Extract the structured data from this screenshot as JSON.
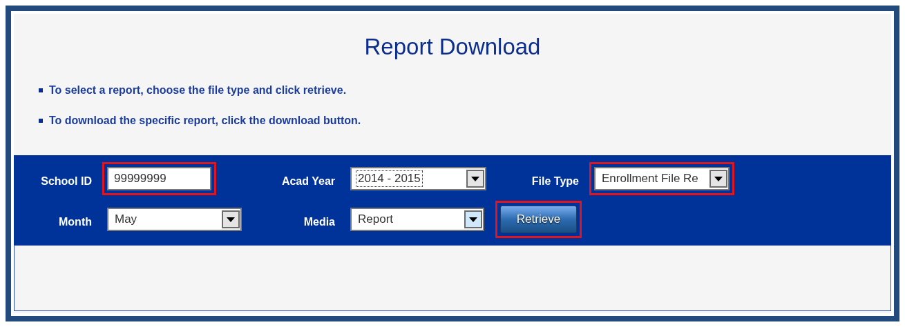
{
  "title": "Report Download",
  "instructions": [
    "To select a report, choose the file type and click retrieve.",
    "To download the specific report, click the download button."
  ],
  "form": {
    "rows": [
      [
        {
          "kind": "text",
          "label": "School ID",
          "value": "99999999",
          "highlighted": true
        },
        {
          "kind": "select",
          "label": "Acad Year",
          "value": "2014 - 2015",
          "highlighted": false,
          "focused": true,
          "hovered": false
        },
        {
          "kind": "select",
          "label": "File Type",
          "value": "Enrollment File Re",
          "highlighted": true,
          "focused": false,
          "hovered": false
        }
      ],
      [
        {
          "kind": "select",
          "label": "Month",
          "value": "May",
          "highlighted": false,
          "focused": false,
          "hovered": false
        },
        {
          "kind": "select",
          "label": "Media",
          "value": "Report",
          "highlighted": false,
          "focused": false,
          "hovered": true
        },
        {
          "kind": "button",
          "label": "Retrieve",
          "highlighted": true
        }
      ]
    ]
  }
}
